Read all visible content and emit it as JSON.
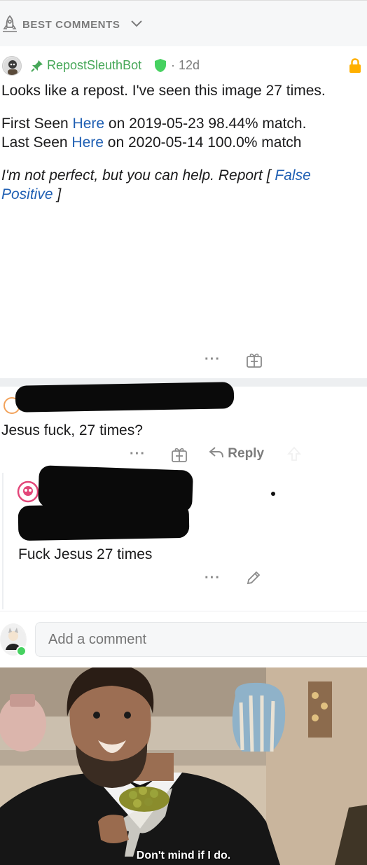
{
  "sort": {
    "label": "BEST COMMENTS"
  },
  "bot_comment": {
    "username": "RepostSleuthBot",
    "separator": "·",
    "age": "12d",
    "line1": "Looks like a repost. I've seen this image 27 times.",
    "first_seen_prefix": "First Seen ",
    "first_seen_link": "Here",
    "first_seen_suffix": " on 2019-05-23 98.44% match.",
    "last_seen_prefix": "Last Seen ",
    "last_seen_link": "Here",
    "last_seen_suffix": " on 2020-05-14 100.0% match",
    "italic_prefix": "I'm not perfect, but you can help. Report [ ",
    "report_link_a": "False",
    "report_link_b": "Positive",
    "italic_suffix": " ]"
  },
  "comment2": {
    "text": "Jesus fuck, 27 times?",
    "reply_label": "Reply"
  },
  "reply1": {
    "text": "Fuck Jesus 27 times"
  },
  "add_comment": {
    "placeholder": "Add a comment"
  },
  "meme": {
    "caption": "Don't mind if I do."
  },
  "colors": {
    "accent_green": "#46a758",
    "link_blue": "#1f5fb3",
    "lock_yellow": "#ffb000"
  }
}
